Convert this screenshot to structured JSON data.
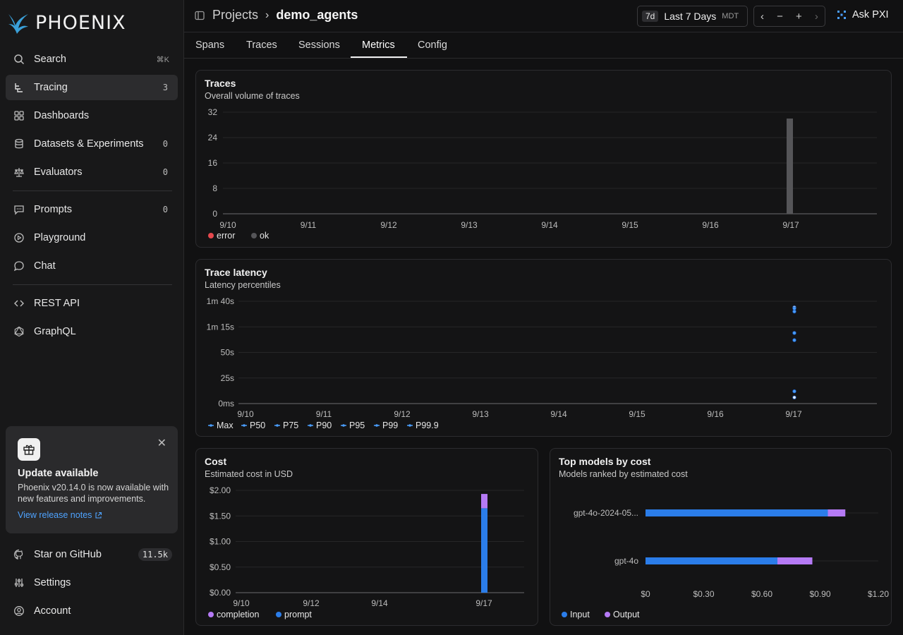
{
  "brand": {
    "name": "PHOENIX"
  },
  "sidebar": {
    "items": [
      {
        "label": "Search",
        "icon": "search-icon",
        "kbd": "⌘K"
      },
      {
        "label": "Tracing",
        "icon": "tracing-icon",
        "count": "3"
      },
      {
        "label": "Dashboards",
        "icon": "grid-icon"
      },
      {
        "label": "Datasets & Experiments",
        "icon": "database-icon",
        "count": "0"
      },
      {
        "label": "Evaluators",
        "icon": "scale-icon",
        "count": "0"
      },
      {
        "label": "Prompts",
        "icon": "prompt-icon",
        "count": "0"
      },
      {
        "label": "Playground",
        "icon": "play-icon"
      },
      {
        "label": "Chat",
        "icon": "chat-icon"
      },
      {
        "label": "REST API",
        "icon": "code-icon"
      },
      {
        "label": "GraphQL",
        "icon": "graphql-icon"
      },
      {
        "label": "Star on GitHub",
        "icon": "github-icon",
        "badge": "11.5k"
      },
      {
        "label": "Settings",
        "icon": "sliders-icon"
      },
      {
        "label": "Account",
        "icon": "user-icon"
      }
    ],
    "update": {
      "title": "Update available",
      "desc": "Phoenix v20.14.0 is now available with new features and improvements.",
      "link": "View release notes"
    }
  },
  "header": {
    "breadcrumb_parent": "Projects",
    "breadcrumb_current": "demo_agents",
    "range_short": "7d",
    "range_label": "Last 7 Days",
    "timezone": "MDT",
    "ask_label": "Ask PXI"
  },
  "tabs": [
    "Spans",
    "Traces",
    "Sessions",
    "Metrics",
    "Config"
  ],
  "colors": {
    "error": "#e5484d",
    "ok": "#555558",
    "prompt": "#2b7de9",
    "completion": "#b57af5",
    "input": "#2b7de9",
    "output": "#b57af5",
    "latency": "#4a9eff"
  },
  "chart_data": [
    {
      "type": "bar",
      "title": "Traces",
      "subtitle": "Overall volume of traces",
      "categories": [
        "9/10",
        "9/11",
        "9/12",
        "9/13",
        "9/14",
        "9/15",
        "9/16",
        "9/17"
      ],
      "yticks": [
        "0",
        "8",
        "16",
        "24",
        "32"
      ],
      "ylim": [
        0,
        32
      ],
      "series": [
        {
          "name": "error",
          "values": [
            0,
            0,
            0,
            0,
            0,
            0,
            0,
            0
          ]
        },
        {
          "name": "ok",
          "values": [
            0,
            0,
            0,
            0,
            0,
            0,
            0,
            30
          ]
        }
      ],
      "legend": "bottom-left"
    },
    {
      "type": "scatter",
      "title": "Trace latency",
      "subtitle": "Latency percentiles",
      "categories": [
        "9/10",
        "9/11",
        "9/12",
        "9/13",
        "9/14",
        "9/15",
        "9/16",
        "9/17"
      ],
      "yticks": [
        "0ms",
        "25s",
        "50s",
        "1m 15s",
        "1m 40s"
      ],
      "ylim_seconds": [
        0,
        100
      ],
      "series": [
        {
          "name": "Max",
          "x": "9/17",
          "y": 94
        },
        {
          "name": "P50",
          "x": "9/17",
          "y": 6
        },
        {
          "name": "P75",
          "x": "9/17",
          "y": 12
        },
        {
          "name": "P90",
          "x": "9/17",
          "y": 62
        },
        {
          "name": "P95",
          "x": "9/17",
          "y": 69
        },
        {
          "name": "P99",
          "x": "9/17",
          "y": 90
        },
        {
          "name": "P99.9",
          "x": "9/17",
          "y": 93
        }
      ],
      "legend": "bottom-left"
    },
    {
      "type": "bar",
      "title": "Cost",
      "subtitle": "Estimated cost in USD",
      "categories": [
        "9/10",
        "9/12",
        "9/14",
        "9/17"
      ],
      "yticks": [
        "$0.00",
        "$0.50",
        "$1.00",
        "$1.50",
        "$2.00"
      ],
      "ylim": [
        0,
        2
      ],
      "stacked": true,
      "series": [
        {
          "name": "prompt",
          "values": [
            0,
            0,
            0,
            1.65
          ]
        },
        {
          "name": "completion",
          "values": [
            0,
            0,
            0,
            0.28
          ]
        }
      ],
      "legend": "bottom-left"
    },
    {
      "type": "bar",
      "orientation": "horizontal",
      "title": "Top models by cost",
      "subtitle": "Models ranked by estimated cost",
      "categories": [
        "gpt-4o-2024-05...",
        "gpt-4o"
      ],
      "xticks": [
        "$0",
        "$0.30",
        "$0.60",
        "$0.90",
        "$1.20"
      ],
      "xlim": [
        0,
        1.2
      ],
      "stacked": true,
      "series": [
        {
          "name": "Input",
          "values": [
            0.94,
            0.68
          ]
        },
        {
          "name": "Output",
          "values": [
            0.09,
            0.18
          ]
        }
      ],
      "legend": "bottom-left"
    }
  ]
}
